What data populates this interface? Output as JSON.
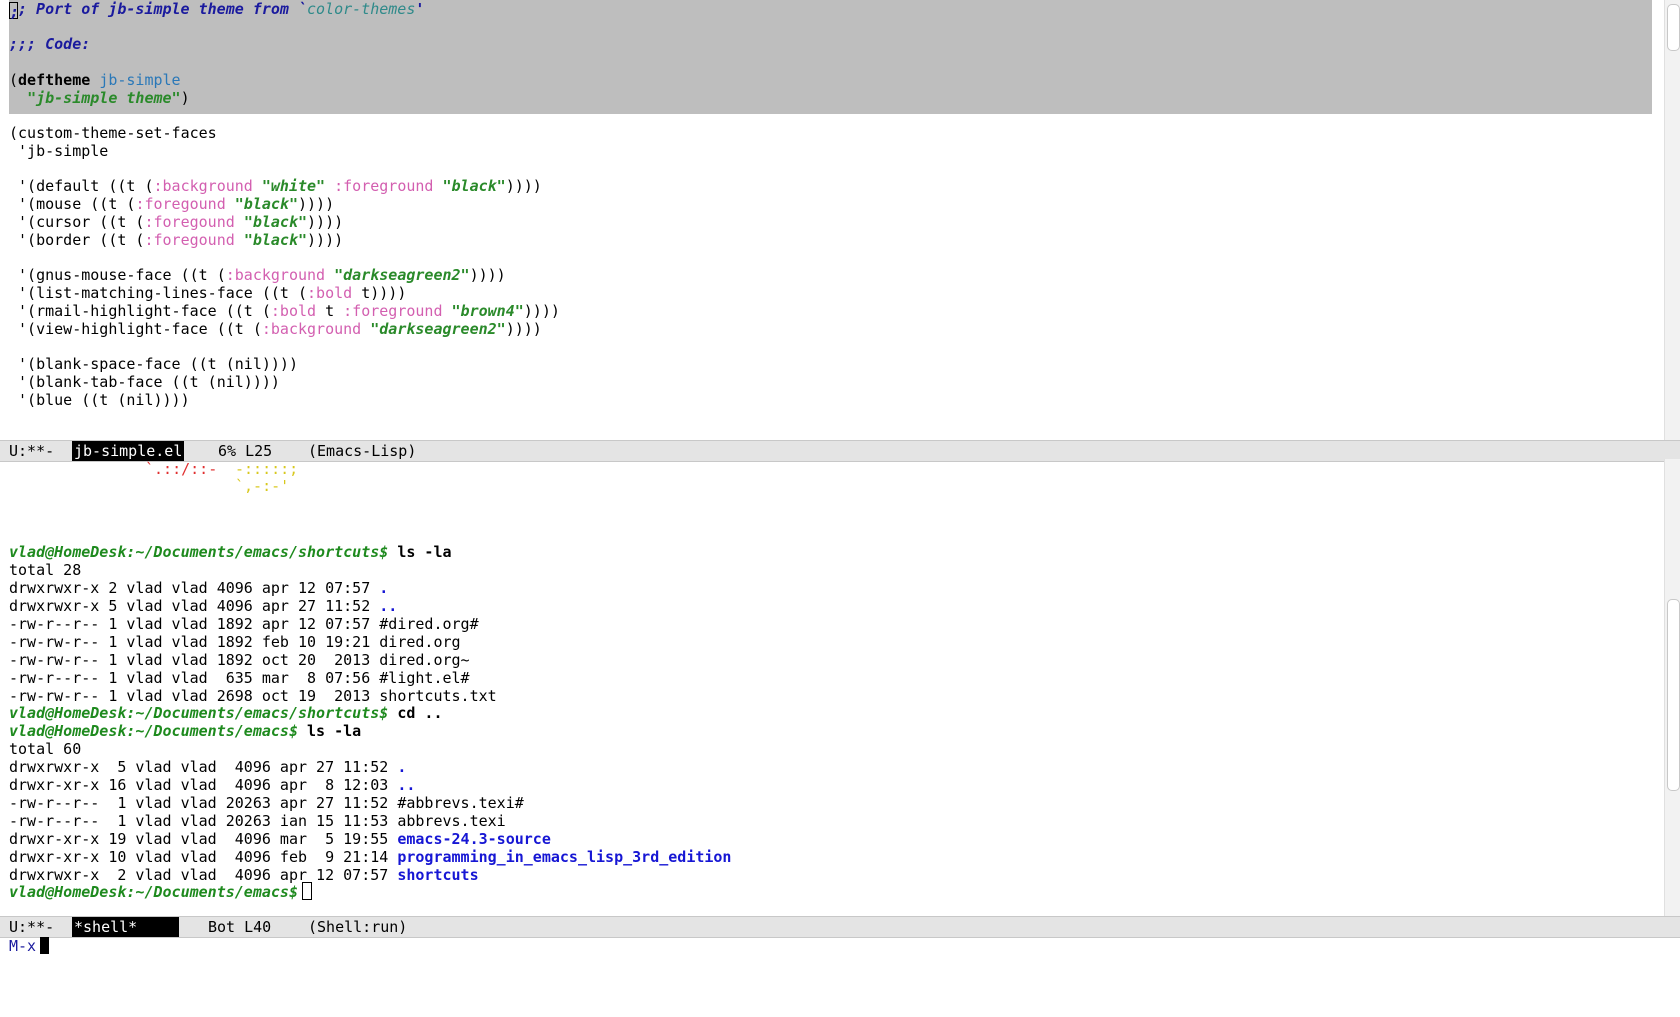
{
  "editor": {
    "comment_prefix": ";",
    "comment_rest": "; Port of jb-simple theme from `",
    "comment_const": "color-themes",
    "comment_end": "'",
    "code_comment": ";;; Code:",
    "deftheme_open": "(",
    "deftheme_kw": "deftheme",
    "deftheme_name": "jb-simple",
    "theme_desc_str": "\"jb-simple theme\"",
    "theme_desc_close": ")",
    "set_faces": "(custom-theme-set-faces",
    "theme_quote": " 'jb-simple",
    "faces": {
      "default_a": " '(default ((t (",
      "default_bg": ":background",
      "default_white": "\"white\"",
      "default_fg": ":foreground",
      "default_black": "\"black\"",
      "default_end": "))))",
      "mouse_a": " '(mouse ((t (",
      "mouse_prop": ":foregound",
      "mouse_val": "\"black\"",
      "mouse_end": "))))",
      "cursor_a": " '(cursor ((t (",
      "cursor_prop": ":foregound",
      "cursor_val": "\"black\"",
      "cursor_end": "))))",
      "border_a": " '(border ((t (",
      "border_prop": ":foregound",
      "border_val": "\"black\"",
      "border_end": "))))",
      "gnus_a": " '(gnus-mouse-face ((t (",
      "gnus_prop": ":background",
      "gnus_val": "\"darkseagreen2\"",
      "gnus_end": "))))",
      "list_a": " '(list-matching-lines-face ((t (",
      "list_prop": ":bold",
      "list_end": " t))))",
      "rmail_a": " '(rmail-highlight-face ((t (",
      "rmail_bold": ":bold",
      "rmail_t": " t ",
      "rmail_fg": ":foreground",
      "rmail_val": "\"brown4\"",
      "rmail_end": "))))",
      "view_a": " '(view-highlight-face ((t (",
      "view_prop": ":background",
      "view_val": "\"darkseagreen2\"",
      "view_end": "))))",
      "blank_space": " '(blank-space-face ((t (nil))))",
      "blank_tab": " '(blank-tab-face ((t (nil))))",
      "blue": " '(blue ((t (nil))))"
    }
  },
  "modeline_top": {
    "status": "U:**-",
    "buffer": "jb-simple.el",
    "position": "6% L25",
    "mode": "(Emacs-Lisp)"
  },
  "shell": {
    "art_line1_red": "`.::/::-",
    "art_line1_yellow": "-:::::;",
    "art_line2_yellow": "`,-:-'",
    "prompt1": "vlad@HomeDesk:~/Documents/emacs/shortcuts$",
    "cmd1": "ls -la",
    "total1": "total 28",
    "listing1": [
      {
        "meta": "drwxrwxr-x 2 vlad vlad 4096 apr 12 07:57 ",
        "name": ".",
        "dir": true
      },
      {
        "meta": "drwxrwxr-x 5 vlad vlad 4096 apr 27 11:52 ",
        "name": "..",
        "dir": true
      },
      {
        "meta": "-rw-r--r-- 1 vlad vlad 1892 apr 12 07:57 ",
        "name": "#dired.org#",
        "dir": false
      },
      {
        "meta": "-rw-rw-r-- 1 vlad vlad 1892 feb 10 19:21 ",
        "name": "dired.org",
        "dir": false
      },
      {
        "meta": "-rw-rw-r-- 1 vlad vlad 1892 oct 20  2013 ",
        "name": "dired.org~",
        "dir": false
      },
      {
        "meta": "-rw-r--r-- 1 vlad vlad  635 mar  8 07:56 ",
        "name": "#light.el#",
        "dir": false
      },
      {
        "meta": "-rw-rw-r-- 1 vlad vlad 2698 oct 19  2013 ",
        "name": "shortcuts.txt",
        "dir": false
      }
    ],
    "prompt2": "vlad@HomeDesk:~/Documents/emacs/shortcuts$",
    "cmd2": "cd ..",
    "prompt3": "vlad@HomeDesk:~/Documents/emacs$",
    "cmd3": "ls -la",
    "total2": "total 60",
    "listing2": [
      {
        "meta": "drwxrwxr-x  5 vlad vlad  4096 apr 27 11:52 ",
        "name": ".",
        "dir": true
      },
      {
        "meta": "drwxr-xr-x 16 vlad vlad  4096 apr  8 12:03 ",
        "name": "..",
        "dir": true
      },
      {
        "meta": "-rw-r--r--  1 vlad vlad 20263 apr 27 11:52 ",
        "name": "#abbrevs.texi#",
        "dir": false
      },
      {
        "meta": "-rw-r--r--  1 vlad vlad 20263 ian 15 11:53 ",
        "name": "abbrevs.texi",
        "dir": false
      },
      {
        "meta": "drwxr-xr-x 19 vlad vlad  4096 mar  5 19:55 ",
        "name": "emacs-24.3-source",
        "dir": true
      },
      {
        "meta": "drwxr-xr-x 10 vlad vlad  4096 feb  9 21:14 ",
        "name": "programming_in_emacs_lisp_3rd_edition",
        "dir": true
      },
      {
        "meta": "drwxrwxr-x  2 vlad vlad  4096 apr 12 07:57 ",
        "name": "shortcuts",
        "dir": true
      }
    ],
    "prompt4": "vlad@HomeDesk:~/Documents/emacs$"
  },
  "modeline_bottom": {
    "status": "U:**-",
    "buffer": "*shell*",
    "position": "Bot L40",
    "mode": "(Shell:run)"
  },
  "minibuffer": {
    "text": "M-x"
  },
  "colors": {
    "region": "#bebebe",
    "comment": "#1a1a9e",
    "string": "#2a8a2a",
    "property": "#d35fb0",
    "function_name": "#2a78b8",
    "prompt": "#1e8a1e",
    "directory": "#1616d4"
  }
}
